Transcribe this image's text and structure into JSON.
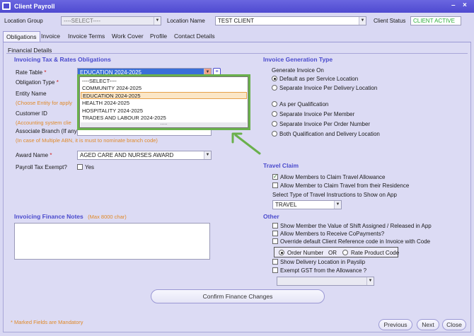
{
  "window": {
    "title": "Client Payroll"
  },
  "topbar": {
    "location_group_label": "Location Group",
    "location_group_value": "----SELECT----",
    "location_name_label": "Location Name",
    "location_name_value": "TEST CLIENT",
    "client_status_label": "Client Status",
    "client_status_value": "CLIENT ACTIVE"
  },
  "tabs": [
    "Obligations",
    "Invoice",
    "Invoice Terms",
    "Work Cover",
    "Profile",
    "Contact Details"
  ],
  "panel_title": "Financial Details",
  "left": {
    "section_title": "Invoicing Tax & Rates Obligations",
    "rate_table_label": "Rate Table",
    "rate_table_value": "EDUCATION 2024-2025",
    "obligation_type_label": "Obligation Type",
    "entity_name_label": "Entity Name",
    "entity_hint": "(Choose Entity for apply",
    "customer_id_label": "Customer ID",
    "customer_hint": "(Accounting system clie",
    "associate_branch_label": "Associate Branch (If any)",
    "branch_hint": "(In case of Multiple ABN, it is must to nominate branch code)",
    "award_name_label": "Award Name",
    "award_name_value": "AGED CARE AND NURSES AWARD",
    "payroll_tax_label": "Payroll Tax Exempt?",
    "payroll_tax_yes": "Yes",
    "notes_title": "Invoicing Finance Notes",
    "notes_max": "(Max 8000 char)",
    "required_mark": "*"
  },
  "dropdown": {
    "options": [
      "----SELECT----",
      "COMMUNITY 2024-2025",
      "EDUCATION 2024-2025",
      "HEALTH 2024-2025",
      "HOSPITALITY 2024-2025",
      "TRADES AND LABOUR 2024-2025"
    ],
    "selected_index": 2,
    "resize_grip": "....."
  },
  "right": {
    "invoice_generation_title": "Invoice Generation Type",
    "generate_on_label": "Generate Invoice On",
    "radios": [
      {
        "label": "Default as per Service Location",
        "checked": true
      },
      {
        "label": "Separate Invoice Per Delivery Location",
        "checked": false
      },
      {
        "label": "As per Qualification",
        "checked": false
      },
      {
        "label": "Separate Invoice Per Member",
        "checked": false
      },
      {
        "label": "Separate Invoice Per Order Number",
        "checked": false
      },
      {
        "label": "Both Qualification and Delivery Location",
        "checked": false
      }
    ],
    "travel_title": "Travel Claim",
    "travel_checks": [
      {
        "label": "Allow Members to Claim Travel Allowance",
        "checked": true
      },
      {
        "label": "Allow Member to Claim Travel from their Residence",
        "checked": false
      }
    ],
    "travel_select_label": "Select Type of Travel Instructions to Show on App",
    "travel_select_value": "TRAVEL",
    "other_title": "Other",
    "other_checks": [
      {
        "label": "Show Member the Value of Shift Assigned / Released in App",
        "checked": false
      },
      {
        "label": "Allow Members to Receive CoPayments?",
        "checked": false
      },
      {
        "label": "Override default Client Reference code in Invoice with Code",
        "checked": false
      }
    ],
    "order_number_label": "Order Number",
    "or_label": "OR",
    "rate_product_label": "Rate Product Code",
    "other_checks_2": [
      {
        "label": "Show Delivery Location in Payslip",
        "checked": false
      },
      {
        "label": "Exempt GST from the Allowance ?",
        "checked": false
      }
    ]
  },
  "confirm_button": "Confirm Finance Changes",
  "footer": {
    "mandatory_note": "* Marked Fields are Mandatory",
    "previous": "Previous",
    "next": "Next",
    "close": "Close"
  },
  "colors": {
    "title_bar": "#4f4ad0",
    "section_title": "#4a4acd",
    "hint": "#e08a2a",
    "status": "#2fae3a",
    "highlight": "#6ab04c"
  }
}
